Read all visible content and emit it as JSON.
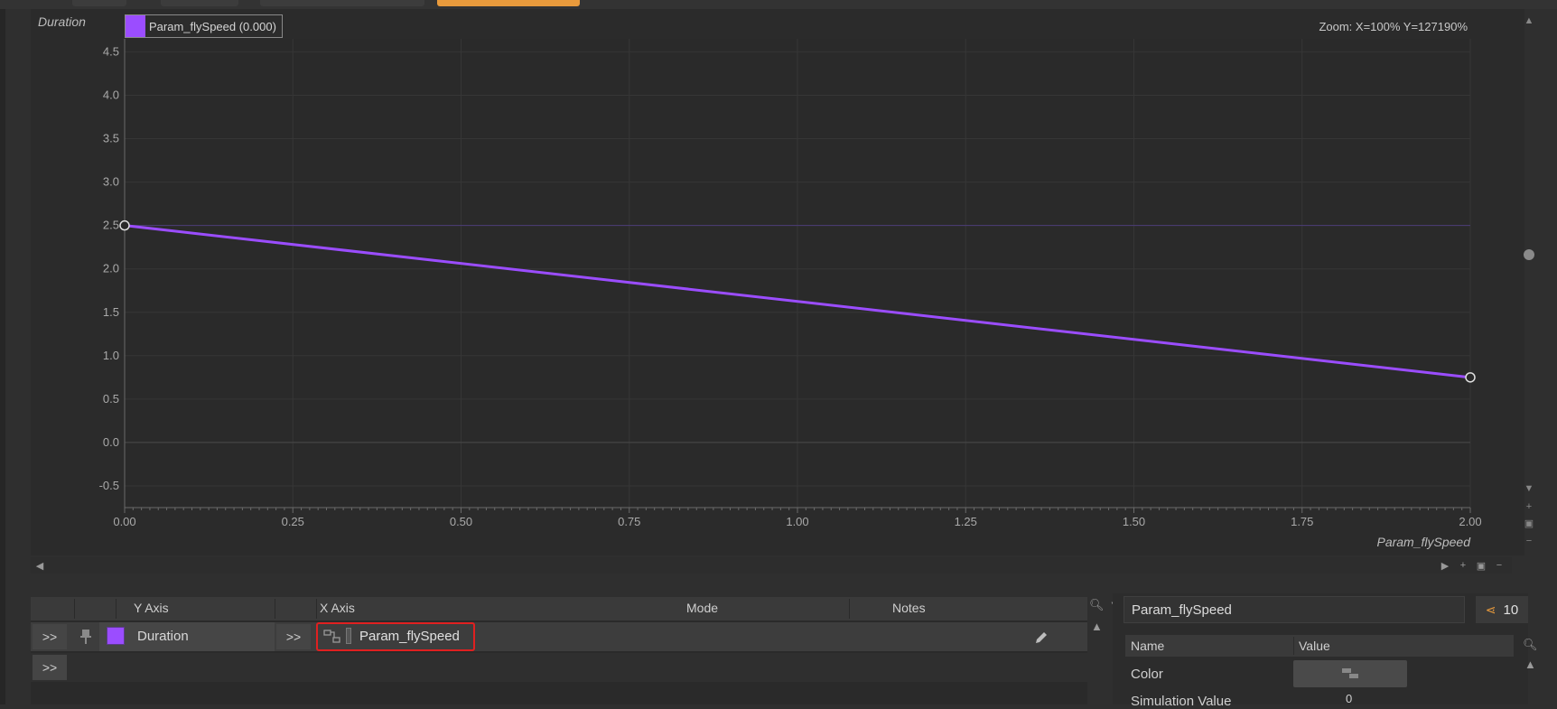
{
  "graph": {
    "y_axis_title": "Duration",
    "x_axis_title": "Param_flySpeed",
    "legend_label": "Param_flySpeed (0.000)",
    "zoom_readout": "Zoom: X=100% Y=127190%",
    "series_color": "#9b4dff"
  },
  "chart_data": {
    "type": "line",
    "xlabel": "Param_flySpeed",
    "ylabel": "Duration",
    "xlim": [
      0,
      2
    ],
    "ylim": [
      -0.75,
      4.65
    ],
    "x_ticks": [
      "0.00",
      "0.25",
      "0.50",
      "0.75",
      "1.00",
      "1.25",
      "1.50",
      "1.75",
      "2.00"
    ],
    "y_ticks": [
      "4.5",
      "4.0",
      "3.5",
      "3.0",
      "2.5",
      "2.0",
      "1.5",
      "1.0",
      "0.5",
      "0.0",
      "-0.5"
    ],
    "series": [
      {
        "x": [
          0.0,
          2.0
        ],
        "y": [
          2.5,
          0.75
        ]
      }
    ],
    "grid": true
  },
  "table": {
    "headers": [
      "Y Axis",
      "X Axis",
      "Mode",
      "Notes"
    ],
    "rows": [
      {
        "expand": ">>",
        "y_axis": "Duration",
        "x_expand": ">>",
        "x_axis": "Param_flySpeed"
      },
      {
        "expand": ">>"
      }
    ]
  },
  "inspector": {
    "title": "Param_flySpeed",
    "count": "10",
    "headers": [
      "Name",
      "Value"
    ],
    "properties": [
      {
        "name": "Color",
        "value": ""
      },
      {
        "name": "Simulation Value",
        "value": "0"
      }
    ]
  },
  "icons": [
    "pin-icon",
    "curve-icon",
    "pencil-icon",
    "search-icon",
    "filter-icon",
    "share-icon",
    "plus-icon",
    "minus-icon",
    "fit-icon"
  ]
}
